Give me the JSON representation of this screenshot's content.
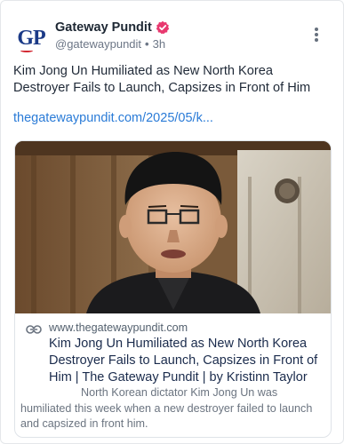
{
  "author": {
    "avatar_text": "GP",
    "display_name": "Gateway Pundit",
    "handle": "@gatewaypundit",
    "separator": "•",
    "time_ago": "3h",
    "verified_color": "#e8396f"
  },
  "post": {
    "text": "Kim Jong Un Humiliated as New North Korea Destroyer Fails to Launch, Capsizes in Front of Him",
    "link_text": "thegatewaypundit.com/2025/05/k..."
  },
  "card": {
    "domain": "www.thegatewaypundit.com",
    "title": "Kim Jong Un Humiliated as New North Korea Destroyer Fails to Launch, Capsizes in Front of Him | The Gateway Pundit | by Kristinn Taylor",
    "description": "North Korean dictator Kim Jong Un was humiliated this week when a new destroyer failed to launch and capsized in front him."
  },
  "icons": {
    "more": "more-vertical-icon",
    "verified": "verified-badge-icon",
    "link": "link-icon"
  },
  "colors": {
    "link": "#2a7bd7",
    "brand_blue": "#1b3a87",
    "brand_red": "#d22630"
  }
}
